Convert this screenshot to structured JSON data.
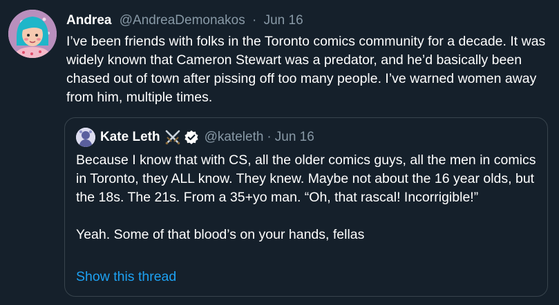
{
  "tweet": {
    "display_name": "Andrea",
    "handle": "@AndreaDemonakos",
    "separator": "·",
    "date": "Jun 16",
    "text": "I’ve been friends with folks in the Toronto comics community for a decade. It was widely known that Cameron Stewart was a predator, and he’d basically been chased out of town after pissing off too many people. I’ve warned women away from him, multiple times."
  },
  "quoted_tweet": {
    "display_name": "Kate Leth",
    "name_icon": "crossed-swords-icon",
    "verified_icon": "verified-badge-icon",
    "handle": "@kateleth",
    "separator": "·",
    "date": "Jun 16",
    "text": "Because I know that with CS, all the older comics guys, all the men in comics in Toronto, they ALL know. They knew. Maybe not about the 16 year olds, but the 18s. The 21s. From a 35+yo man. “Oh, that rascal! Incorrigible!”\n\nYeah. Some of that blood’s on your hands, fellas",
    "show_thread_label": "Show this thread"
  },
  "colors": {
    "background": "#15202b",
    "muted_text": "#8899a6",
    "link": "#1da1f2",
    "border": "#38444d"
  }
}
